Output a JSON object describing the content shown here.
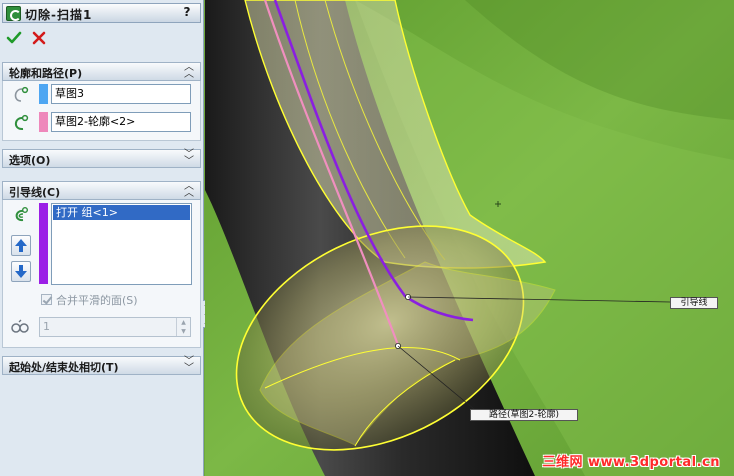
{
  "feature": {
    "title": "切除-扫描1",
    "help": "?"
  },
  "sections": {
    "profile_path": {
      "title": "轮廓和路径(P)",
      "profile_field": "草图3",
      "path_field": "草图2-轮廓<2>",
      "profile_color": "#4ea6f2",
      "path_color": "#ee88bb"
    },
    "options": {
      "title": "选项(O)"
    },
    "guide_curves": {
      "title": "引导线(C)",
      "list_items": [
        "打开 组<1>"
      ],
      "list_color": "#9b1fe6",
      "merge_smooth_label": "合并平滑的面(S)",
      "section_count": "1"
    },
    "tangency": {
      "title": "起始处/结束处相切(T)"
    }
  },
  "viewport": {
    "callout_guide": "引导线",
    "callout_path": "路径(草图2-轮廓)",
    "watermark": "三维网 www.3dportal.cn",
    "background_color": "#6da93a",
    "highlight_color": "#ffff33"
  }
}
